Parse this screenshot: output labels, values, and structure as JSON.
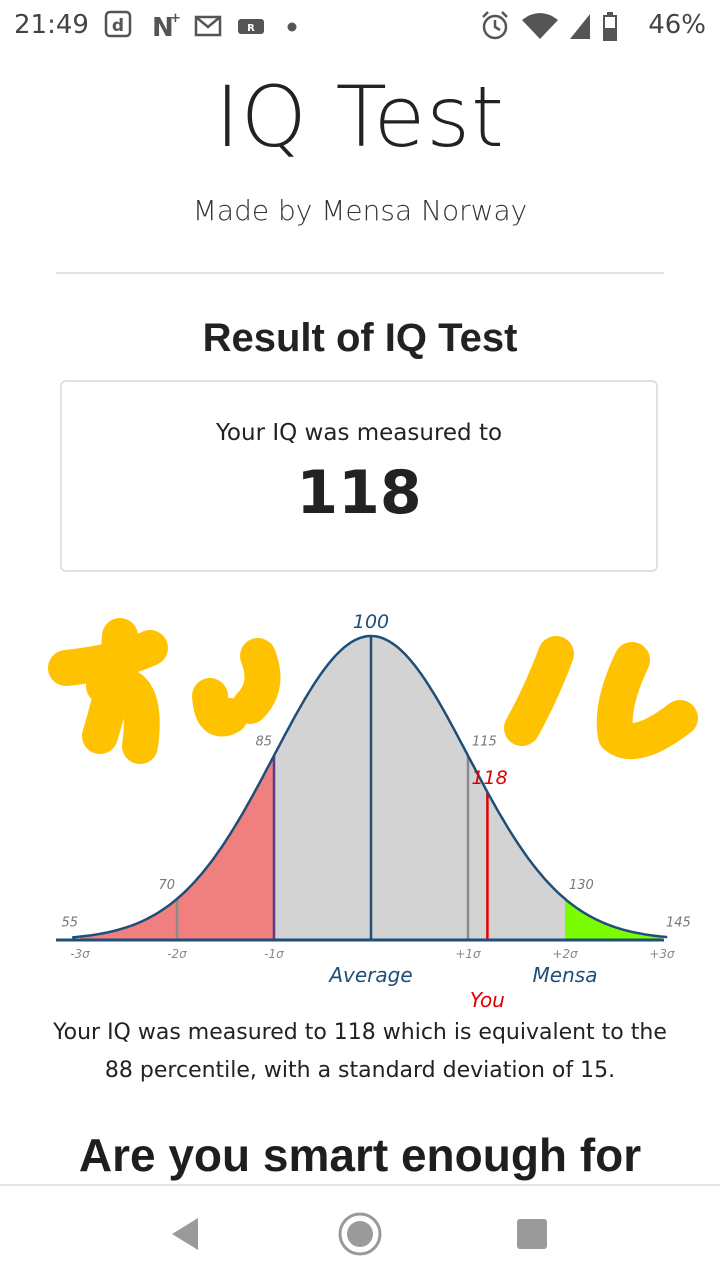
{
  "status_bar": {
    "time": "21:49",
    "battery": "46%",
    "left_icons": [
      "d-app-icon",
      "n-notification-icon",
      "mail-icon",
      "r-app-icon",
      "dot-icon"
    ],
    "right_icons": [
      "alarm-icon",
      "wifi-icon",
      "signal-icon",
      "battery-icon"
    ]
  },
  "header": {
    "title": "IQ Test",
    "subtitle": "Made by Mensa Norway"
  },
  "result": {
    "heading": "Result of IQ Test",
    "label": "Your IQ was measured to",
    "value": "118"
  },
  "description": "Your IQ was measured to 118 which is equivalent to the 88 percentile, with a standard deviation of 15.",
  "cta_heading": "Are you smart enough for",
  "doodle": {
    "text": "かしこ",
    "color": "#FFC200"
  },
  "colors": {
    "low_area": "#F08080",
    "mid_area": "#D3D3D3",
    "high_area": "#7CFC00",
    "curve": "#1F4E79",
    "you_line": "#E00000",
    "label_blue": "#1F4E79",
    "label_red": "#E00000"
  },
  "chart_data": {
    "type": "area",
    "distribution": "normal",
    "mean": 100,
    "sd": 15,
    "xlim": [
      55,
      145
    ],
    "score_labels": [
      {
        "value": 55,
        "text": "55"
      },
      {
        "value": 70,
        "text": "70"
      },
      {
        "value": 85,
        "text": "85"
      },
      {
        "value": 100,
        "text": "100"
      },
      {
        "value": 115,
        "text": "115"
      },
      {
        "value": 130,
        "text": "130"
      },
      {
        "value": 145,
        "text": "145"
      }
    ],
    "sigma_ticks": [
      {
        "value": 55,
        "text": "-3σ"
      },
      {
        "value": 70,
        "text": "-2σ"
      },
      {
        "value": 85,
        "text": "-1σ"
      },
      {
        "value": 115,
        "text": "+1σ"
      },
      {
        "value": 130,
        "text": "+2σ"
      },
      {
        "value": 145,
        "text": "+3σ"
      }
    ],
    "regions": [
      {
        "from": 55,
        "to": 85,
        "color": "#F08080"
      },
      {
        "from": 85,
        "to": 130,
        "color": "#D3D3D3"
      },
      {
        "from": 130,
        "to": 145,
        "color": "#7CFC00"
      }
    ],
    "marker_lines": [
      70,
      85,
      100,
      115
    ],
    "you": {
      "value": 118,
      "text": "118",
      "label": "You"
    },
    "bottom_labels": [
      {
        "value": 100,
        "text": "Average"
      },
      {
        "value": 130,
        "text": "Mensa"
      }
    ]
  }
}
